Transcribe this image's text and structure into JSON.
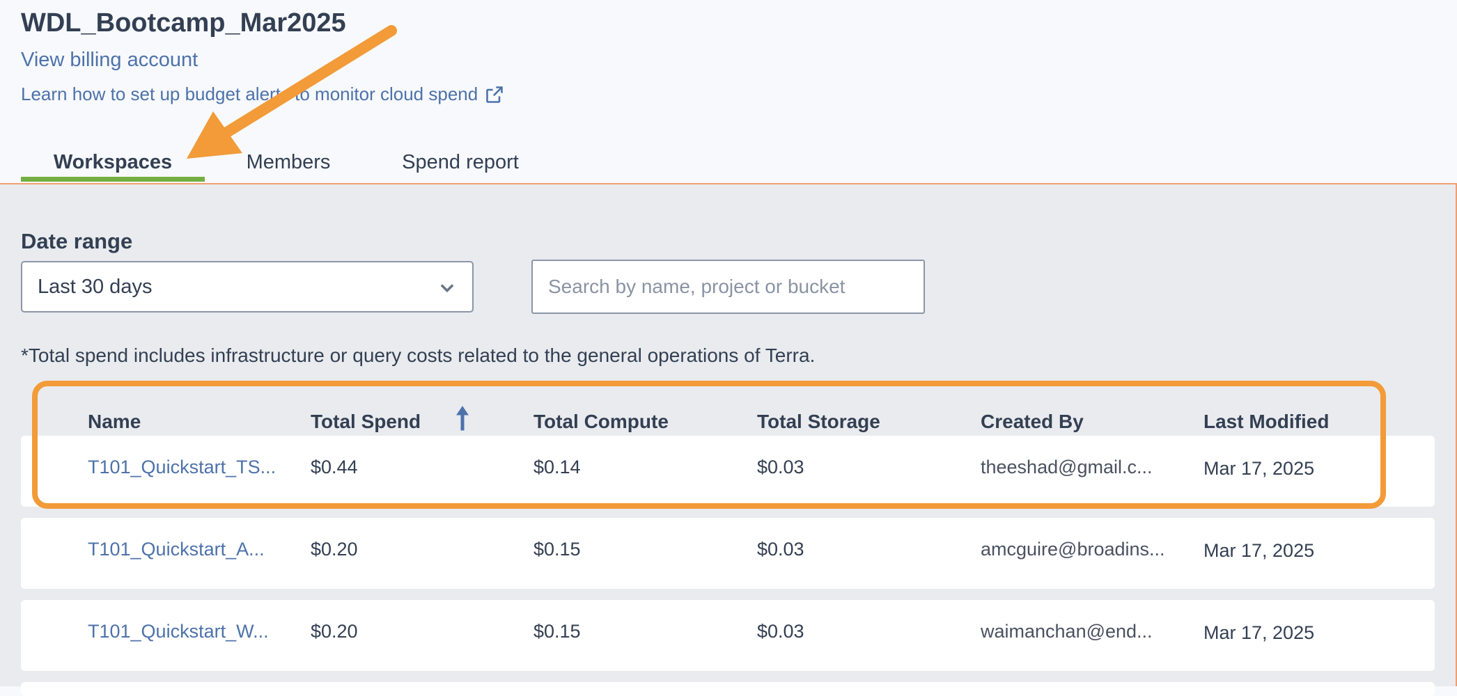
{
  "header": {
    "title": "WDL_Bootcamp_Mar2025",
    "billing_link": "View billing account",
    "learn_link": "Learn how to set up budget alerts to monitor cloud spend"
  },
  "tabs": [
    {
      "label": "Workspaces",
      "active": true
    },
    {
      "label": "Members",
      "active": false
    },
    {
      "label": "Spend report",
      "active": false
    }
  ],
  "filters": {
    "date_range_label": "Date range",
    "date_range_value": "Last 30 days",
    "search_placeholder": "Search by name, project or bucket"
  },
  "note": "*Total spend includes infrastructure or query costs related to the general operations of Terra.",
  "table": {
    "columns": [
      "Name",
      "Total Spend",
      "Total Compute",
      "Total Storage",
      "Created By",
      "Last Modified"
    ],
    "sorted_column": "Total Spend",
    "rows": [
      {
        "name": "T101_Quickstart_TS...",
        "total_spend": "$0.44",
        "total_compute": "$0.14",
        "total_storage": "$0.03",
        "created_by": "theeshad@gmail.c...",
        "last_modified": "Mar 17, 2025"
      },
      {
        "name": "T101_Quickstart_A...",
        "total_spend": "$0.20",
        "total_compute": "$0.15",
        "total_storage": "$0.03",
        "created_by": "amcguire@broadins...",
        "last_modified": "Mar 17, 2025"
      },
      {
        "name": "T101_Quickstart_W...",
        "total_spend": "$0.20",
        "total_compute": "$0.15",
        "total_storage": "$0.03",
        "created_by": "waimanchan@end...",
        "last_modified": "Mar 17, 2025"
      }
    ]
  },
  "colors": {
    "accent_link": "#4d72aa",
    "active_tab_underline": "#74ae43",
    "annotation_orange": "#f29b38"
  },
  "icons": {
    "external_link": "external-link-icon",
    "dropdown": "chevron-down-icon",
    "sort": "sort-up-arrow-icon"
  }
}
